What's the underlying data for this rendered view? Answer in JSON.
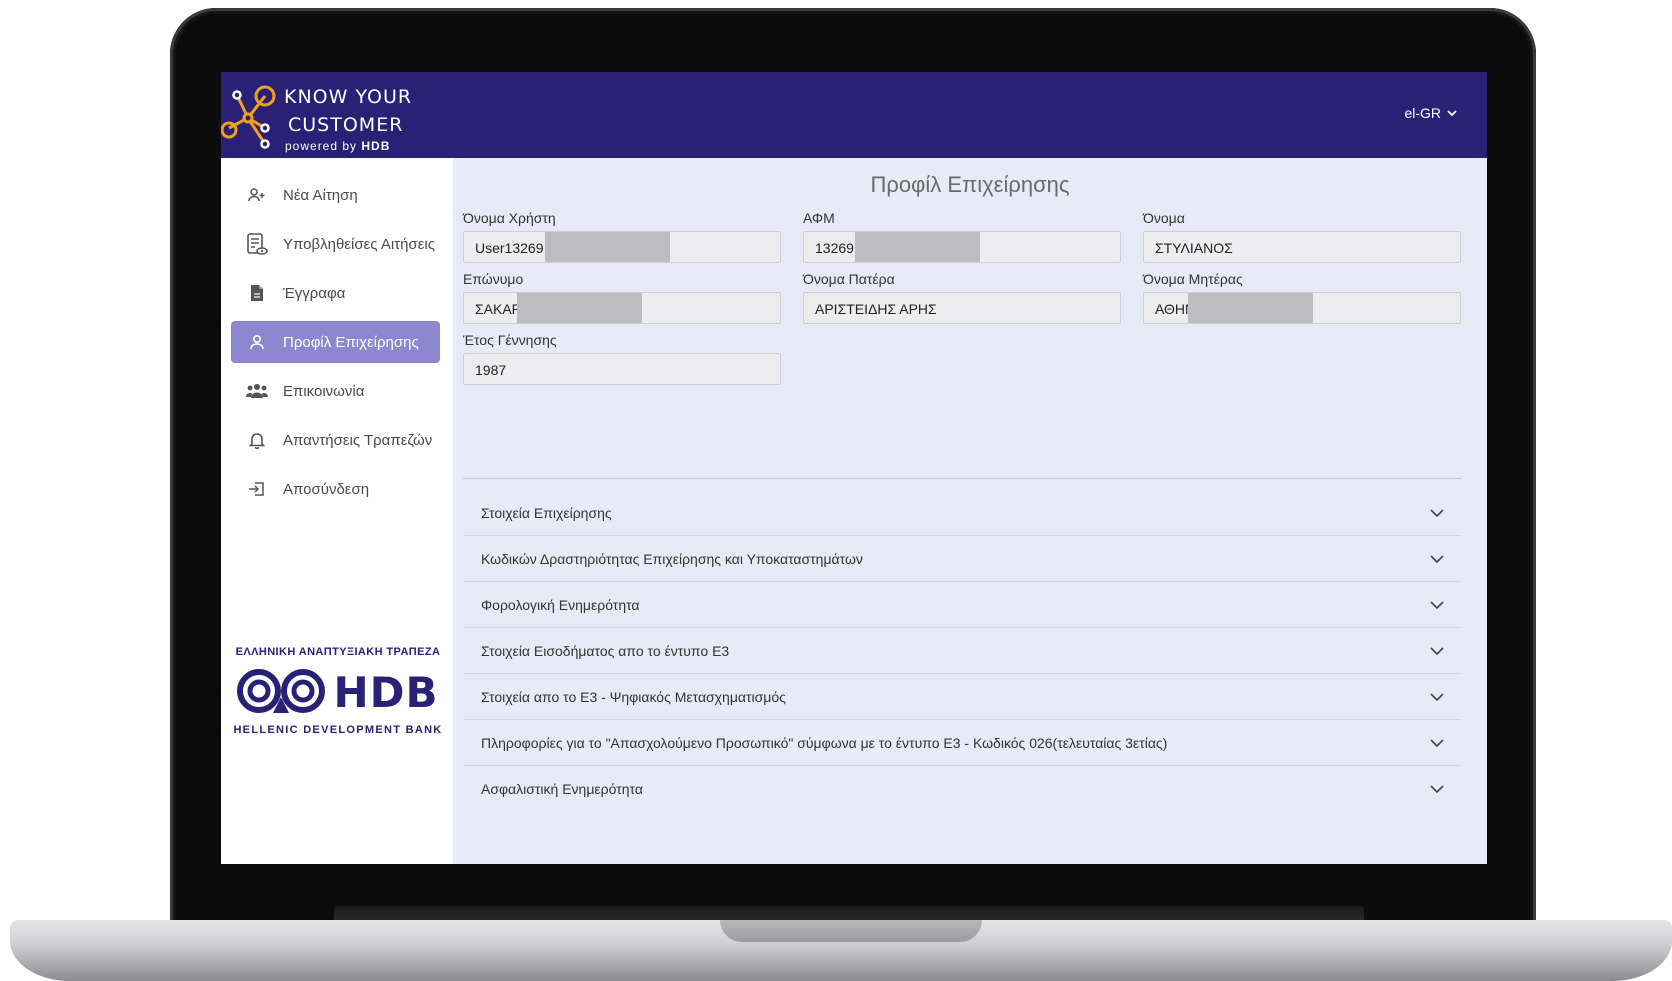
{
  "app": {
    "logo_line1": "KNOW YOUR",
    "logo_line2": "CUSTOMER",
    "logo_powered": "powered by",
    "logo_brand": "HDB",
    "language": "el-GR"
  },
  "sidebar": {
    "items": [
      {
        "label": "Νέα Αίτηση",
        "icon": "add-user-icon",
        "active": false
      },
      {
        "label": "Υποβληθείσες Αιτήσεις",
        "icon": "submitted-list-icon",
        "active": false
      },
      {
        "label": "Έγγραφα",
        "icon": "document-icon",
        "active": false
      },
      {
        "label": "Προφίλ Επιχείρησης",
        "icon": "user-icon",
        "active": true
      },
      {
        "label": "Επικοινωνία",
        "icon": "group-icon",
        "active": false
      },
      {
        "label": "Απαντήσεις Τραπεζών",
        "icon": "bell-icon",
        "active": false
      },
      {
        "label": "Αποσύνδεση",
        "icon": "logout-icon",
        "active": false
      }
    ],
    "bank_logo": {
      "top_text": "ΕΛΛΗΝΙΚΗ ΑΝΑΠΤΥΞΙΑΚΗ ΤΡΑΠΕΖΑ",
      "wordmark": "HDB",
      "bottom_text": "HELLENIC DEVELOPMENT BANK"
    }
  },
  "main": {
    "title": "Προφίλ Επιχείρησης",
    "fields": {
      "username": {
        "label": "Όνομα Χρήστη",
        "value": "User13269"
      },
      "afm": {
        "label": "ΑΦΜ",
        "value": "13269"
      },
      "first_name": {
        "label": "Όνομα",
        "value": "ΣΤΥΛΙΑΝΟΣ"
      },
      "surname": {
        "label": "Επώνυμο",
        "value": "ΣΑΚΑΡ"
      },
      "father_name": {
        "label": "Όνομα Πατέρα",
        "value": "ΑΡΙΣΤΕΙΔΗΣ ΑΡΗΣ"
      },
      "mother_name": {
        "label": "Όνομα Μητέρας",
        "value": "ΑΘΗΝ"
      },
      "birth_year": {
        "label": "Έτος Γέννησης",
        "value": "1987"
      }
    },
    "accordion": [
      "Στοιχεία Επιχείρησης",
      "Κωδικών Δραστηριότητας Επιχείρησης και Υποκαταστημάτων",
      "Φορολογική Ενημερότητα",
      "Στοιχεία Εισοδήματος απο το έντυπο Ε3",
      "Στοιχεία απο το Ε3 - Ψηφιακός Μετασχηματισμός",
      "Πληροφορίες για το \"Απασχολούμενο Προσωπικό\" σύμφωνα με το έντυπο Ε3 - Κωδικός 026(τελευταίας 3ετίας)",
      "Ασφαλιστική Ενημερότητα"
    ]
  },
  "colors": {
    "topbar": "#2a2176",
    "accent_active": "#8e86cf",
    "main_bg": "#e8ebf7",
    "logo_orange": "#f0a020"
  }
}
